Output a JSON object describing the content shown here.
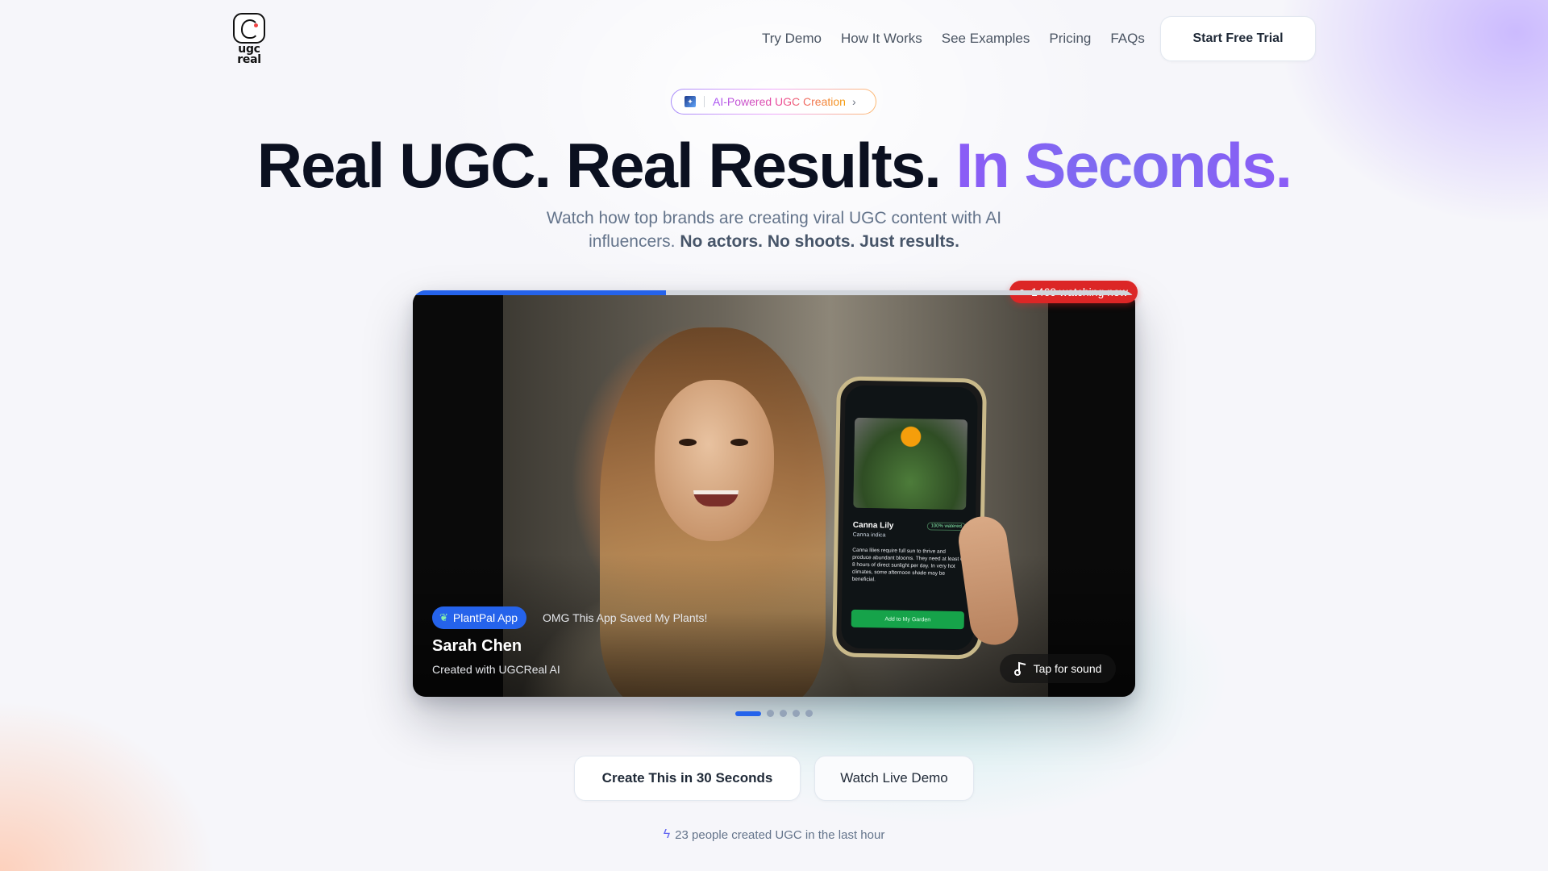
{
  "brand": {
    "logo_text_1": "ugc",
    "logo_text_2": "real"
  },
  "nav": {
    "links": [
      "Try Demo",
      "How It Works",
      "See Examples",
      "Pricing",
      "FAQs"
    ],
    "cta": "Start Free Trial"
  },
  "badge": {
    "text": "AI-Powered UGC Creation",
    "icon": "sparkle-icon",
    "chevron": "›"
  },
  "hero": {
    "headline_main": "Real UGC. Real Results.",
    "headline_accent": "In Seconds.",
    "subtitle_plain": "Watch how top brands are creating viral UGC content with AI influencers.",
    "subtitle_bold": "No actors. No shoots. Just results."
  },
  "video": {
    "progress": 0.35,
    "watching": "1469 watching now",
    "app_tag": "PlantPal App",
    "caption": "OMG This App Saved My Plants!",
    "creator_name": "Sarah Chen",
    "creator_sub": "Created with UGCReal AI",
    "sound_label": "Tap for sound",
    "phone": {
      "plant_name": "Canna Lily",
      "plant_sci": "Canna indica",
      "pill": "100% watered",
      "body": "Canna lilies require full sun to thrive and produce abundant blooms. They need at least 6-8 hours of direct sunlight per day. In very hot climates, some afternoon shade may be beneficial.",
      "button": "Add to My Garden"
    }
  },
  "carousel": {
    "count": 5,
    "active": 0
  },
  "actions": {
    "primary": "Create This in 30 Seconds",
    "secondary": "Watch Live Demo"
  },
  "social_proof": "23 people created UGC in the last hour",
  "colors": {
    "accent": "#8b5cf6",
    "primary_blue": "#2563eb",
    "live_red": "#dc2626"
  }
}
